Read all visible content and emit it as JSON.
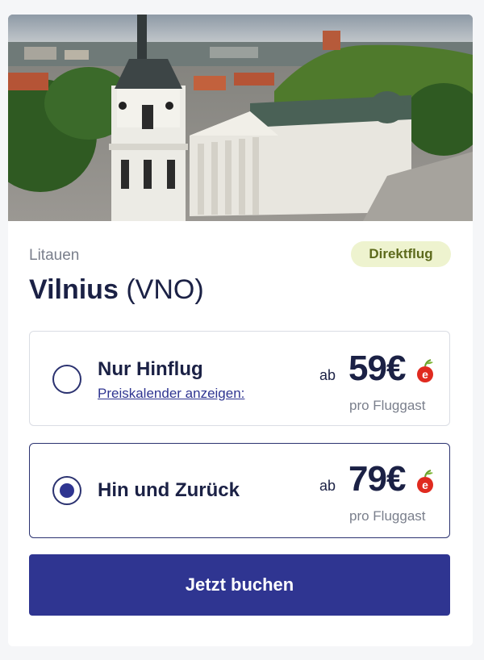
{
  "destination": {
    "country": "Litauen",
    "city": "Vilnius",
    "code": "(VNO)",
    "badge": "Direktflug"
  },
  "options": [
    {
      "label": "Nur Hinflug",
      "link": "Preiskalender anzeigen:",
      "prefix": "ab",
      "price": "59€",
      "per": "pro Fluggast",
      "selected": false
    },
    {
      "label": "Hin und Zurück",
      "prefix": "ab",
      "price": "79€",
      "per": "pro Fluggast",
      "selected": true
    }
  ],
  "cta": {
    "label": "Jetzt buchen"
  },
  "colors": {
    "primary": "#2f3591",
    "text": "#1b2145",
    "muted": "#7a7f8c",
    "badge_bg": "#eef3cf",
    "badge_text": "#5d6a1c",
    "cherry": "#e02a1f"
  },
  "icons": {
    "price_mark": "cherry-e-icon",
    "radio_off": "radio-unselected-icon",
    "radio_on": "radio-selected-icon"
  }
}
